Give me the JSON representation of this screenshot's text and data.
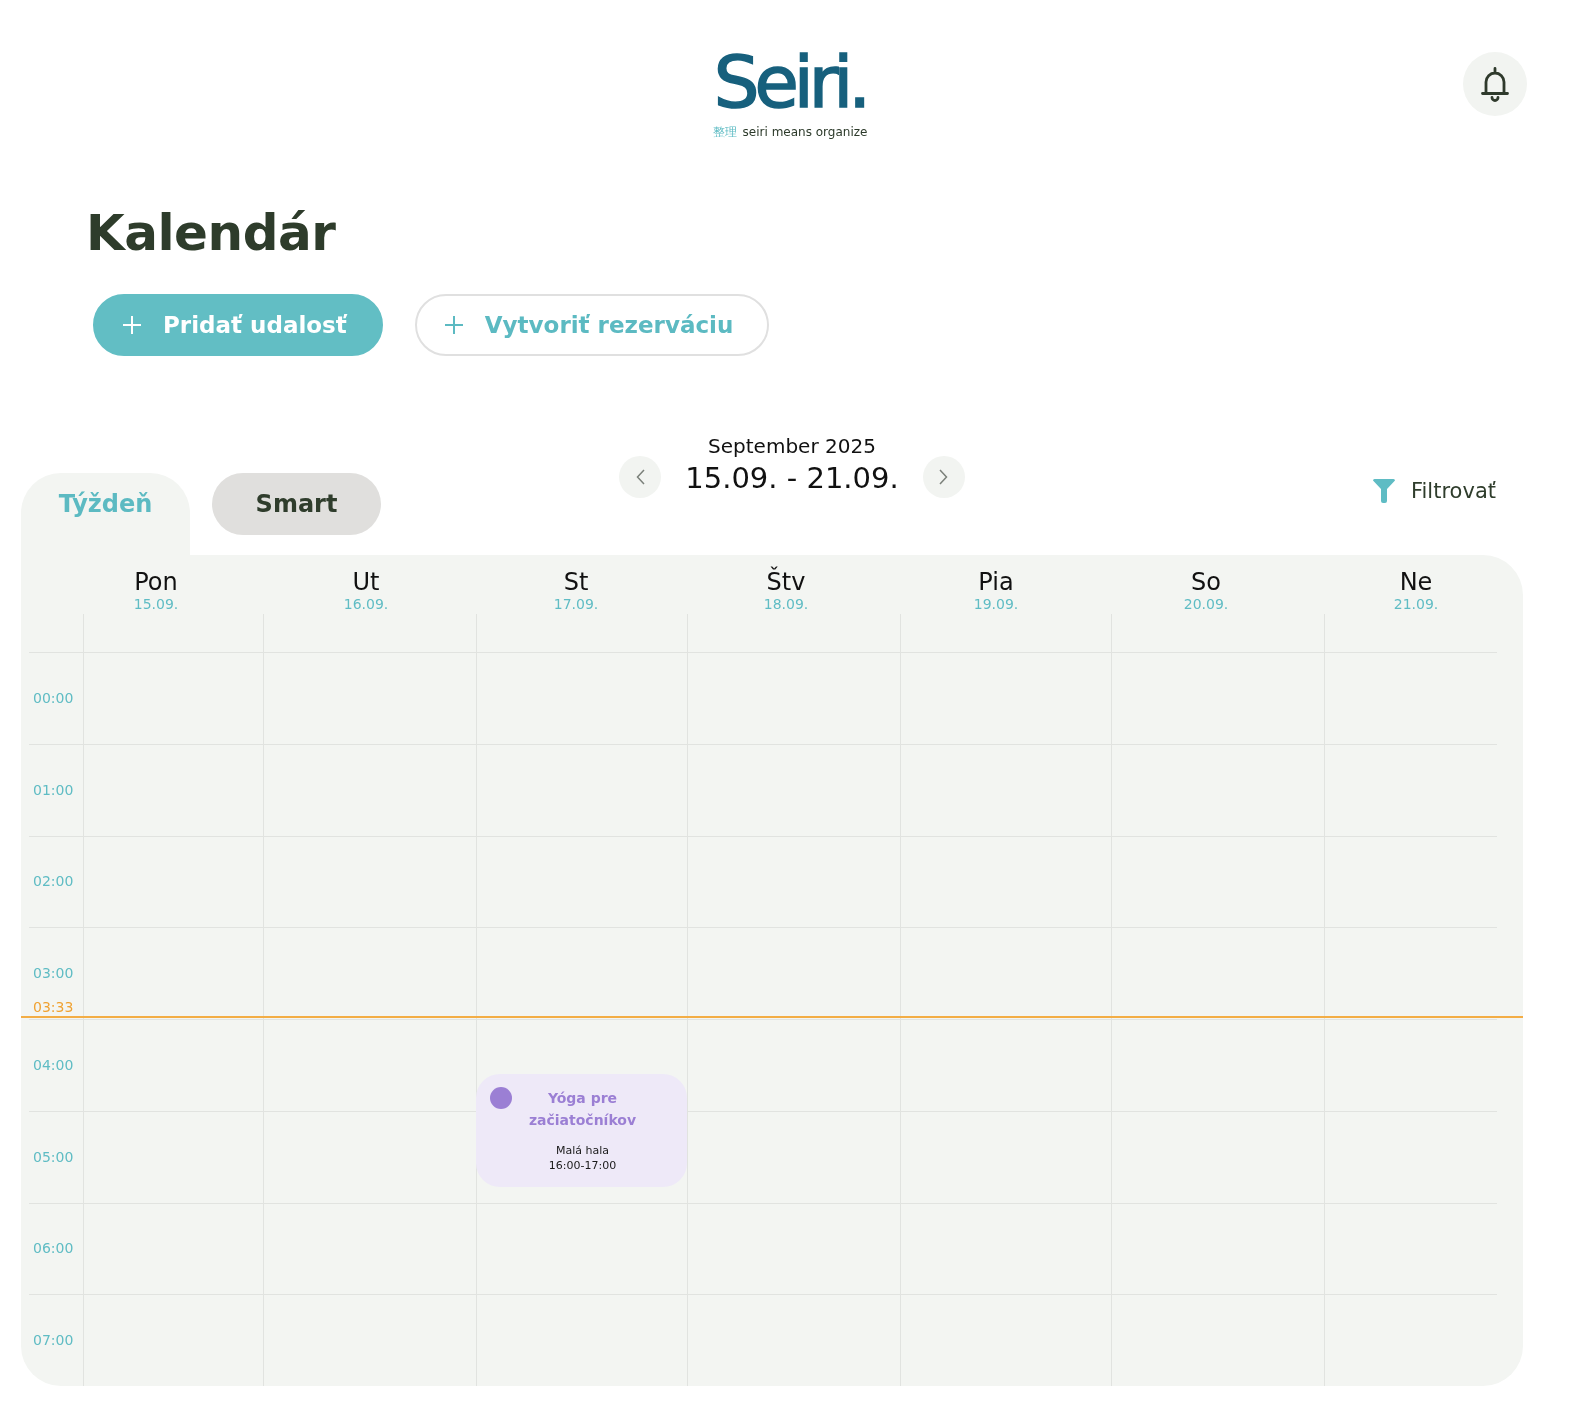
{
  "header": {
    "logo": "Seiri.",
    "tagline_kanji": "整理",
    "tagline": "seiri means organize"
  },
  "page_title": "Kalendár",
  "actions": [
    {
      "label": "Pridať udalosť",
      "kind": "primary"
    },
    {
      "label": "Vytvoriť rezerváciu",
      "kind": "outline"
    }
  ],
  "view_tabs": [
    {
      "label": "Týždeň",
      "selected": true
    },
    {
      "label": "Smart",
      "selected": false
    }
  ],
  "period": {
    "month": "September 2025",
    "range": "15.09. - 21.09."
  },
  "filter": {
    "label": "Filtrovať"
  },
  "calendar": {
    "days": [
      {
        "name": "Pon",
        "date": "15.09."
      },
      {
        "name": "Ut",
        "date": "16.09."
      },
      {
        "name": "St",
        "date": "17.09.",
        "events": [
          {
            "title": "Yóga pre začiatočníkov",
            "location": "Malá hala",
            "time": "16:00-17:00",
            "color": "#9b7fd4"
          }
        ]
      },
      {
        "name": "Štv",
        "date": "18.09."
      },
      {
        "name": "Pia",
        "date": "19.09."
      },
      {
        "name": "So",
        "date": "20.09."
      },
      {
        "name": "Ne",
        "date": "21.09."
      }
    ],
    "hours": [
      "00:00",
      "01:00",
      "02:00",
      "03:00",
      "04:00",
      "05:00",
      "06:00",
      "07:00"
    ],
    "current_time": "03:33"
  }
}
